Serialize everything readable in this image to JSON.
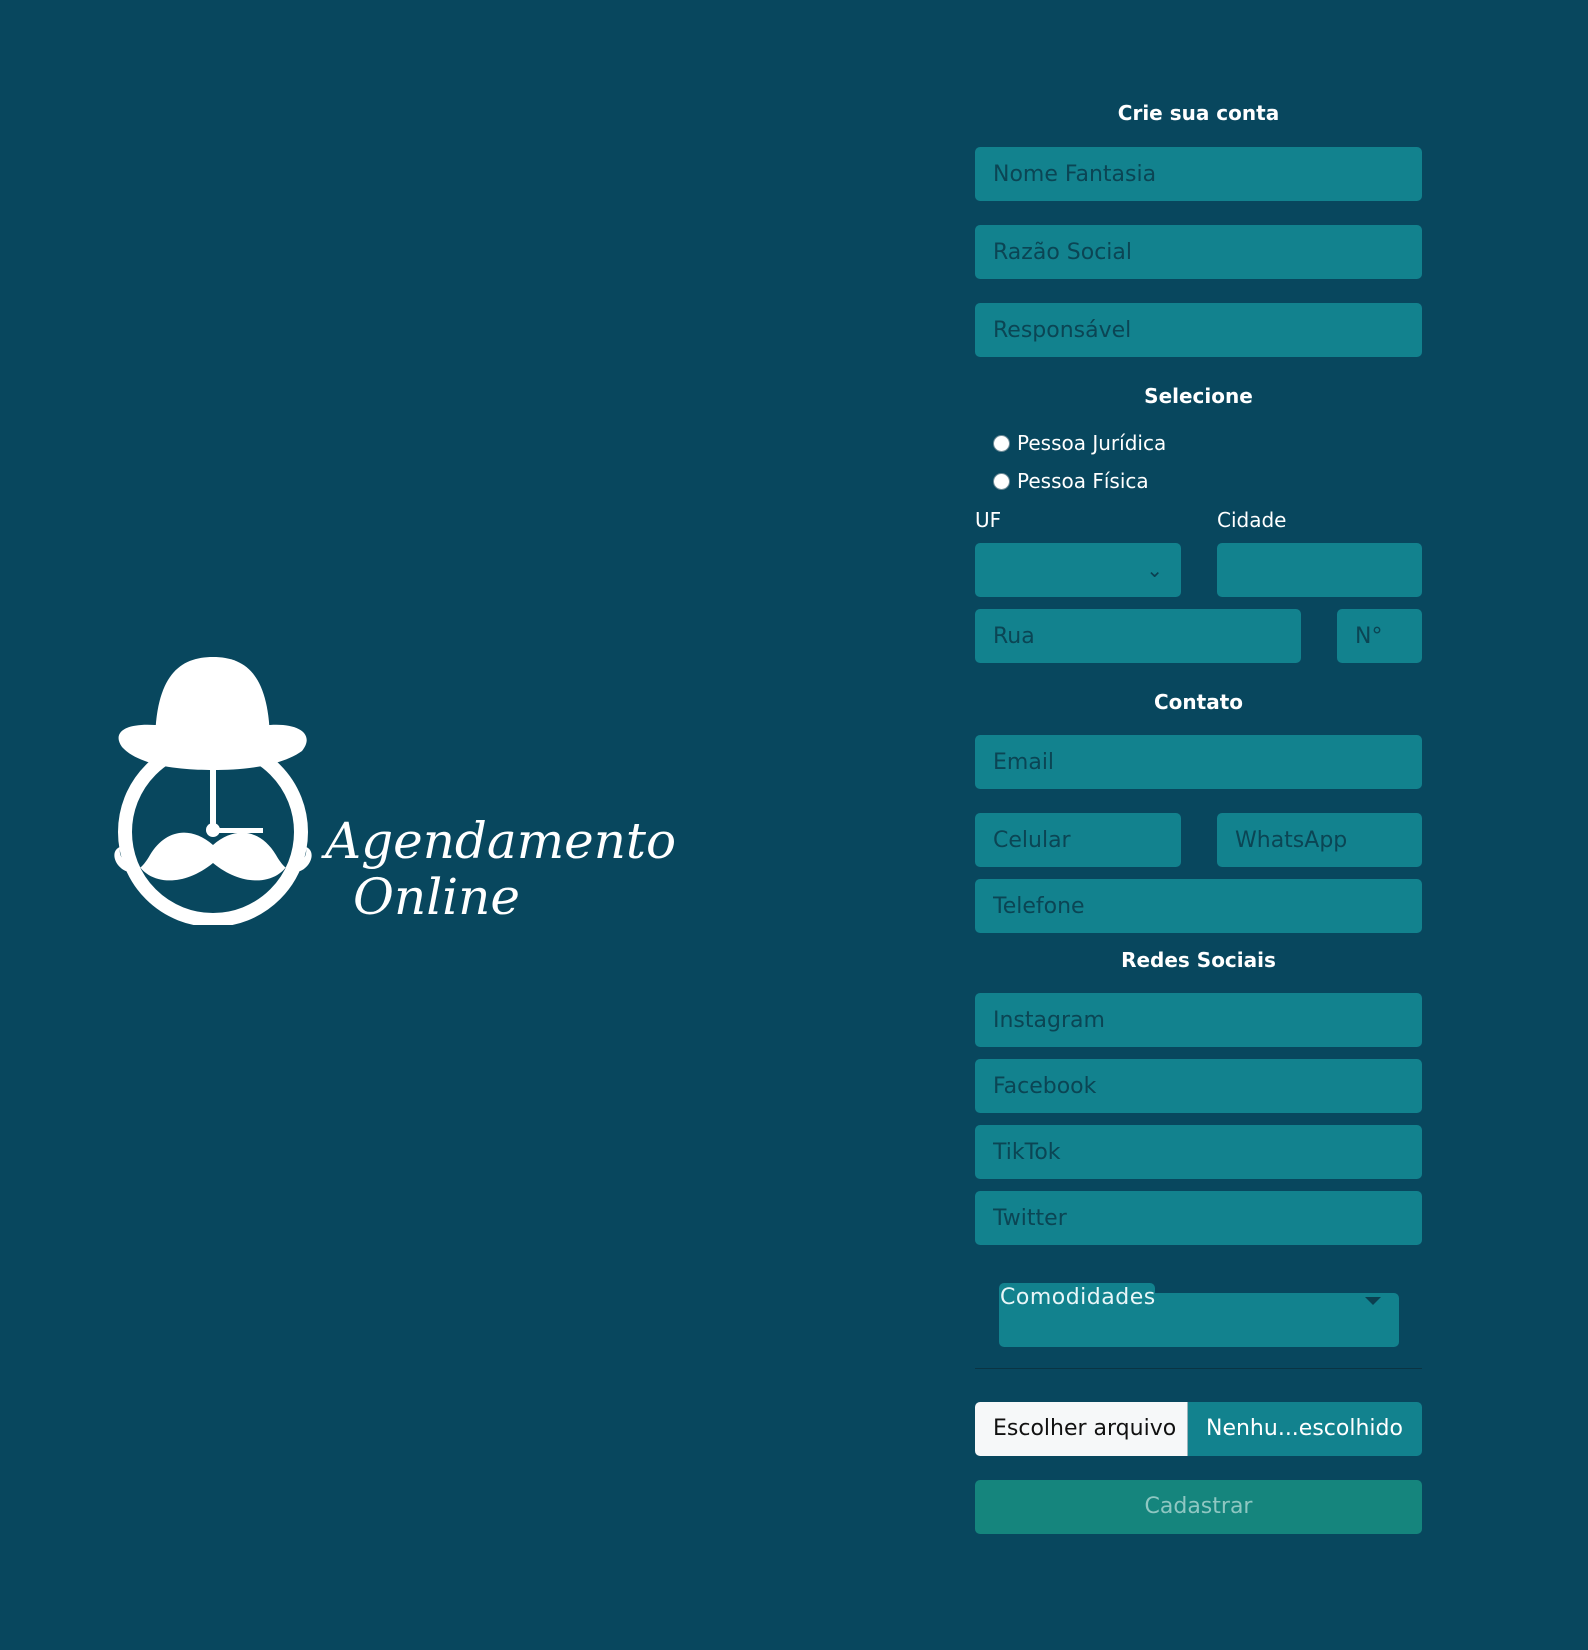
{
  "brand": {
    "line1": "Agendamento",
    "line2": "Online",
    "logo_icon": "bowler-hat-mustache-icon",
    "color": "#ffffff"
  },
  "colors": {
    "background": "#08475e",
    "field": "#12828e",
    "submit": "#15857d"
  },
  "form": {
    "title": "Crie sua conta",
    "fields": {
      "nome_fantasia": {
        "placeholder": "Nome Fantasia",
        "value": ""
      },
      "razao_social": {
        "placeholder": "Razão Social",
        "value": ""
      },
      "responsavel": {
        "placeholder": "Responsável",
        "value": ""
      }
    },
    "select_title": "Selecione",
    "person_type": {
      "options": [
        "Pessoa Jurídica",
        "Pessoa Física"
      ],
      "selected": null
    },
    "address": {
      "uf_label": "UF",
      "uf_value": "",
      "cidade_label": "Cidade",
      "cidade_value": "",
      "rua_placeholder": "Rua",
      "numero_placeholder": "N°"
    },
    "contact_title": "Contato",
    "contact": {
      "email_placeholder": "Email",
      "celular_placeholder": "Celular",
      "whatsapp_placeholder": "WhatsApp",
      "telefone_placeholder": "Telefone"
    },
    "social_title": "Redes Sociais",
    "social": {
      "instagram_placeholder": "Instagram",
      "facebook_placeholder": "Facebook",
      "tiktok_placeholder": "TikTok",
      "twitter_placeholder": "Twitter"
    },
    "amenities_label": "Comodidades",
    "file": {
      "button_label": "Escolher arquivo",
      "status": "Nenhu...escolhido"
    },
    "submit_label": "Cadastrar"
  }
}
